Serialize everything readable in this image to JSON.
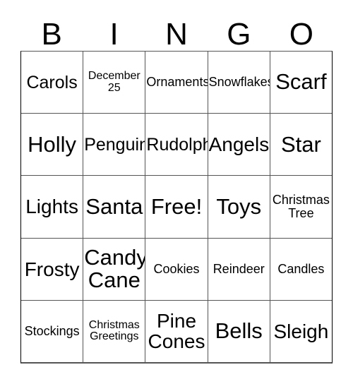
{
  "title": "BINGO Card",
  "header": {
    "letters": [
      "B",
      "I",
      "N",
      "G",
      "O"
    ]
  },
  "grid": {
    "rows": 5,
    "columns": 5,
    "free_space": {
      "row": 2,
      "column": 2,
      "label": "Free!"
    },
    "cells": [
      [
        {
          "label": "Carols",
          "size": "lg"
        },
        {
          "label": "December\n25",
          "size": "sm"
        },
        {
          "label": "Ornaments",
          "size": "md"
        },
        {
          "label": "Snowflakes",
          "size": "md"
        },
        {
          "label": "Scarf",
          "size": "xxl"
        }
      ],
      [
        {
          "label": "Holly",
          "size": "xxl"
        },
        {
          "label": "Penguin",
          "size": "lg"
        },
        {
          "label": "Rudolph",
          "size": "lg"
        },
        {
          "label": "Angels",
          "size": "xl"
        },
        {
          "label": "Star",
          "size": "xxl"
        }
      ],
      [
        {
          "label": "Lights",
          "size": "xl"
        },
        {
          "label": "Santa",
          "size": "xxl"
        },
        {
          "label": "Free!",
          "size": "xxl"
        },
        {
          "label": "Toys",
          "size": "xxl"
        },
        {
          "label": "Christmas\nTree",
          "size": "md"
        }
      ],
      [
        {
          "label": "Frosty",
          "size": "xl"
        },
        {
          "label": "Candy\nCane",
          "size": "xxl"
        },
        {
          "label": "Cookies",
          "size": "md"
        },
        {
          "label": "Reindeer",
          "size": "md"
        },
        {
          "label": "Candles",
          "size": "md"
        }
      ],
      [
        {
          "label": "Stockings",
          "size": "md"
        },
        {
          "label": "Christmas\nGreetings",
          "size": "sm"
        },
        {
          "label": "Pine\nCones",
          "size": "xl"
        },
        {
          "label": "Bells",
          "size": "xxl"
        },
        {
          "label": "Sleigh",
          "size": "xl"
        }
      ]
    ]
  },
  "colors": {
    "background": "#ffffff",
    "text": "#000000",
    "grid_line": "#555555",
    "outer_border": "#000000"
  }
}
